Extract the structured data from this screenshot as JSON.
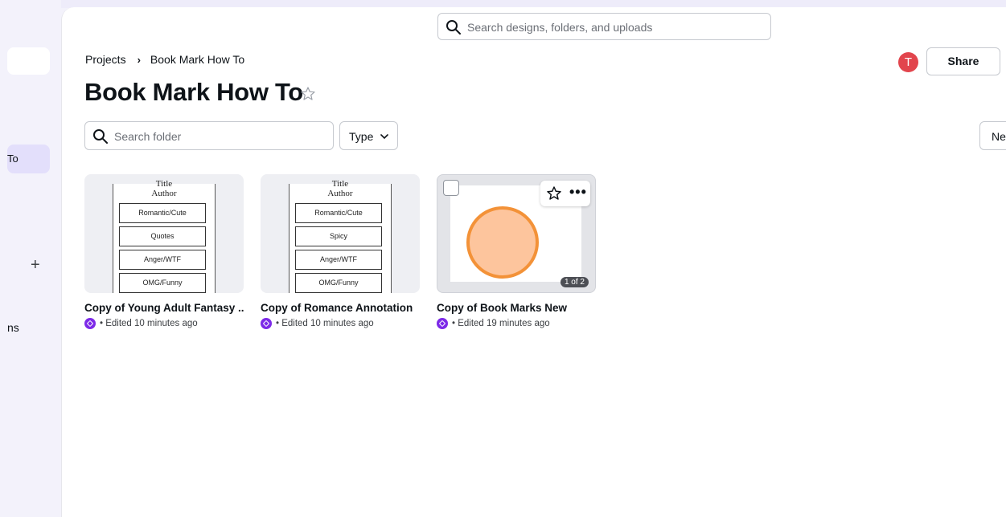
{
  "sidebar": {
    "active_item_label": "To",
    "partial_label": "ns",
    "add_symbol": "+"
  },
  "header": {
    "search_placeholder": "Search designs, folders, and uploads",
    "breadcrumb": {
      "root": "Projects",
      "separator": "›",
      "current": "Book Mark How To"
    },
    "avatar_initial": "T",
    "share_label": "Share"
  },
  "page": {
    "title": "Book Mark How To",
    "folder_search_placeholder": "Search folder",
    "type_filter_label": "Type",
    "new_button_label": "Ne"
  },
  "designs": [
    {
      "title": "Copy of Young Adult Fantasy ...",
      "meta": "• Edited 10 minutes ago",
      "thumb_heading": [
        "Title",
        "Author"
      ],
      "thumb_boxes": [
        "Romantic/Cute",
        "Quotes",
        "Anger/WTF",
        "OMG/Funny"
      ]
    },
    {
      "title": "Copy of Romance Annotation",
      "meta": "• Edited 10 minutes ago",
      "thumb_heading": [
        "Title",
        "Author"
      ],
      "thumb_boxes": [
        "Romantic/Cute",
        "Spicy",
        "Anger/WTF",
        "OMG/Funny"
      ]
    },
    {
      "title": "Copy of Book Marks New",
      "meta": "• Edited 19 minutes ago",
      "page_count": "1 of 2",
      "more_symbol": "•••"
    }
  ],
  "colors": {
    "accent": "#7d2ae8",
    "avatar": "#e2454d",
    "circle_fill": "#fdc59d",
    "circle_stroke": "#f39238"
  }
}
